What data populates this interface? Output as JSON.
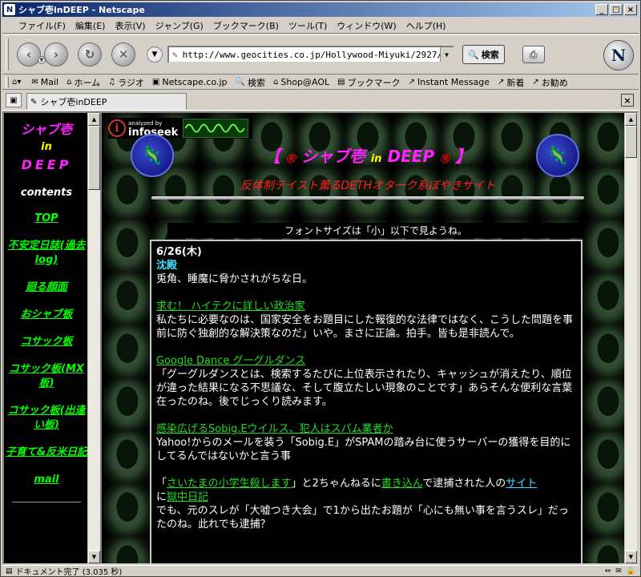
{
  "window": {
    "title": "シャブ壱inDEEP - Netscape"
  },
  "menu": {
    "items": [
      "ファイル(F)",
      "編集(E)",
      "表示(V)",
      "ジャンプ(G)",
      "ブックマーク(B)",
      "ツール(T)",
      "ウィンドウ(W)",
      "ヘルプ(H)"
    ]
  },
  "nav": {
    "url": "http://www.geocities.co.jp/Hollywood-Miyuki/2927/",
    "search_label": "検索"
  },
  "personal": {
    "items": [
      "Mail",
      "ホーム",
      "ラジオ",
      "Netscape.co.jp",
      "検索",
      "Shop@AOL",
      "ブックマーク",
      "Instant Message",
      "新着",
      "お勧め"
    ]
  },
  "tab": {
    "label": "シャブ壱inDEEP"
  },
  "left": {
    "title_line1": "シャブ壱",
    "title_in": "in",
    "title_deep": "DEEP",
    "contents": "contents",
    "links": [
      "TOP",
      "不安定日誌(過去log)",
      "廻る顔面",
      "おシャブ板",
      "コサック板",
      "コサック板(MX板)",
      "コサック板(出逢い板)",
      "子育て&反米日記",
      "mail"
    ]
  },
  "banner": {
    "analyzed_by": "analyzed by",
    "brand": "infoseek"
  },
  "header": {
    "bracket_open": "【",
    "mark_left": "Ⓡ",
    "title_main": "シャブ壱",
    "title_in": "in",
    "title_deep": "DEEP",
    "mark_right": "Ⓡ",
    "bracket_close": "】",
    "subtitle": "反体制テイスト薫るDETHオタ一ク系ぼやきサイト"
  },
  "fontnote": "フォントサイズは「小」以下で見ようね。",
  "diary": {
    "date": "6/26(木)",
    "heading": "沈殿",
    "intro": "兎角、睡魔に脅かされがちな日。",
    "entries": [
      {
        "link": "求む！ ハイテクに詳しい政治家",
        "text": "私たちに必要なのは、国家安全をお題目にした報復的な法律ではなく、こうした問題を事前に防ぐ独創的な解決策なのだ」いや。まさに正論。拍手。皆も是非読んで。"
      },
      {
        "link": "Google Dance グーグルダンス",
        "text": "「グーグルダンスとは、検索するたびに上位表示されたり、キャッシュが消えたり、順位が違った結果になる不思議な、そして腹立たしい現象のことです」あらそんな便利な言葉在ったのね。後でじっくり読みます。"
      },
      {
        "link": "感染広げるSobig.Eウイルス、犯人はスパム業者か",
        "text": "Yahoo!からのメールを装う「Sobig.E」がSPAMの踏み台に使うサーバーの獲得を目的にしてるんではないかと言う事"
      }
    ],
    "last": {
      "q_open": "「",
      "link1": "さいたまの小学生殺します",
      "mid1": "」と2ちゃんねるに",
      "link2": "書き込ん",
      "mid2": "で逮捕された人の",
      "link3": "サイト",
      "mid3": "に",
      "link4": "獄中日記",
      "tail": "でも、元のスレが「大嘘つき大会」で1から出たお題が「心にも無い事を言うスレ」だったのね。此れでも逮捕？"
    }
  },
  "status": {
    "text": "ドキュメント完了 (3.035 秒)"
  },
  "colors": {
    "title_magenta": "#ff22ff",
    "accent_yellow": "#ffff00",
    "link_green": "#22dd22",
    "heading_cyan": "#40e0ff",
    "subtitle_red": "#ff2222"
  }
}
